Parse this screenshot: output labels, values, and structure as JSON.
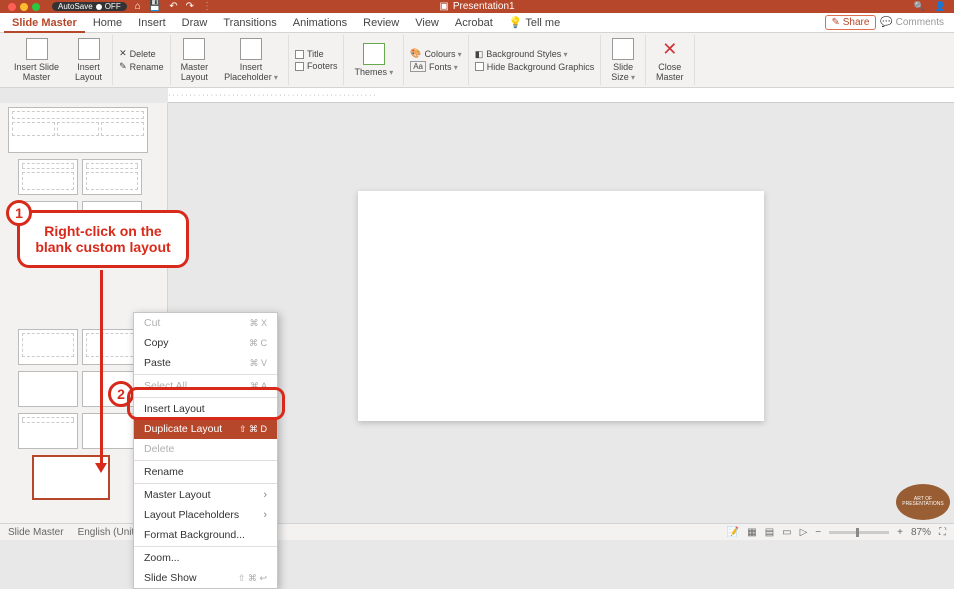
{
  "titlebar": {
    "autosave_label": "AutoSave",
    "autosave_state": "OFF",
    "doc_title": "Presentation1"
  },
  "tabs": {
    "items": [
      "Slide Master",
      "Home",
      "Insert",
      "Draw",
      "Transitions",
      "Animations",
      "Review",
      "View",
      "Acrobat"
    ],
    "tell_me": "Tell me",
    "share": "Share",
    "comments": "Comments",
    "active_index": 0
  },
  "ribbon": {
    "insert_slide_master": "Insert Slide\nMaster",
    "insert_layout": "Insert\nLayout",
    "delete": "Delete",
    "rename": "Rename",
    "master_layout": "Master\nLayout",
    "insert_placeholder": "Insert\nPlaceholder",
    "title": "Title",
    "footers": "Footers",
    "themes": "Themes",
    "colours": "Colours",
    "fonts": "Fonts",
    "bg_styles": "Background Styles",
    "hide_bg": "Hide Background Graphics",
    "slide_size": "Slide\nSize",
    "close_master": "Close\nMaster"
  },
  "context_menu": {
    "cut": "Cut",
    "cut_key": "⌘ X",
    "copy": "Copy",
    "copy_key": "⌘ C",
    "paste": "Paste",
    "paste_key": "⌘ V",
    "select_all": "Select All",
    "select_all_key": "⌘ A",
    "insert_layout": "Insert Layout",
    "duplicate_layout": "Duplicate Layout",
    "duplicate_key": "⇧ ⌘ D",
    "delete": "Delete",
    "rename": "Rename",
    "master_layout": "Master Layout",
    "layout_placeholders": "Layout Placeholders",
    "format_bg": "Format Background...",
    "zoom": "Zoom...",
    "slide_show": "Slide Show",
    "slide_show_key": "⇧ ⌘ ↩"
  },
  "callouts": {
    "c1_num": "1",
    "c1_text_l1": "Right-click on the",
    "c1_text_l2": "blank custom layout",
    "c2_num": "2"
  },
  "statusbar": {
    "mode": "Slide Master",
    "lang": "English (Unite",
    "zoom": "87%"
  },
  "logo": {
    "line1": "ART OF",
    "line2": "PRESENTATIONS"
  }
}
